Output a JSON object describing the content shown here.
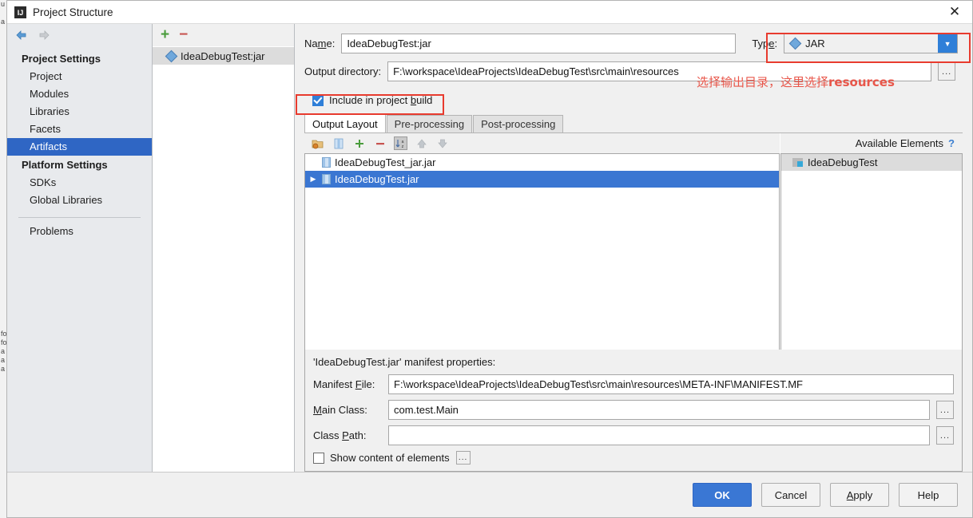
{
  "background_fragments": [
    "u",
    "a",
    "",
    "",
    "",
    "",
    "",
    "",
    "fo",
    "fo",
    "a",
    "a",
    "a"
  ],
  "window": {
    "icon": "intellij-idea-icon",
    "title": "Project Structure",
    "close_label": "✕"
  },
  "nav": {
    "back_icon": "arrow-left-icon",
    "forward_icon": "arrow-right-icon",
    "groups": [
      {
        "label": "Project Settings",
        "items": [
          {
            "label": "Project",
            "selected": false
          },
          {
            "label": "Modules",
            "selected": false
          },
          {
            "label": "Libraries",
            "selected": false
          },
          {
            "label": "Facets",
            "selected": false
          },
          {
            "label": "Artifacts",
            "selected": true
          }
        ]
      },
      {
        "label": "Platform Settings",
        "items": [
          {
            "label": "SDKs",
            "selected": false
          },
          {
            "label": "Global Libraries",
            "selected": false
          }
        ]
      }
    ],
    "problems": {
      "label": "Problems"
    }
  },
  "artifacts_panel": {
    "add_label": "+",
    "remove_label": "−",
    "items": [
      {
        "label": "IdeaDebugTest:jar",
        "selected": true
      }
    ]
  },
  "editor": {
    "name": {
      "label": "Name:",
      "value": "IdeaDebugTest:jar"
    },
    "type": {
      "label": "Type:",
      "value": "JAR",
      "arrow": "▼"
    },
    "output_directory": {
      "label": "Output directory:",
      "value": "F:\\workspace\\IdeaProjects\\IdeaDebugTest\\src\\main\\resources",
      "browse_label": "..."
    },
    "include_in_build": {
      "label_prefix": "Include in project ",
      "label_mnemonic": "b",
      "label_suffix": "uild",
      "checked": true
    },
    "tabs": [
      {
        "label": "Output Layout",
        "active": true
      },
      {
        "label": "Pre-processing",
        "active": false
      },
      {
        "label": "Post-processing",
        "active": false
      }
    ],
    "layout_toolbar": [
      {
        "name": "add-directory-icon",
        "glyph": "◪",
        "pressed": false
      },
      {
        "name": "add-archive-icon",
        "glyph": "▓",
        "pressed": false
      },
      {
        "name": "add-icon",
        "glyph": "+",
        "pressed": false
      },
      {
        "name": "remove-icon",
        "glyph": "−",
        "pressed": false
      },
      {
        "name": "sort-az-icon",
        "glyph": "↓",
        "pressed": true
      },
      {
        "name": "move-up-icon",
        "glyph": "↑",
        "pressed": false
      },
      {
        "name": "move-down-icon",
        "glyph": "↓",
        "pressed": false
      }
    ],
    "tree": [
      {
        "label": "IdeaDebugTest_jar.jar",
        "selected": false,
        "twisty": "",
        "indent": 0
      },
      {
        "label": "IdeaDebugTest.jar",
        "selected": true,
        "twisty": "▶",
        "indent": 0
      }
    ],
    "available_elements": {
      "title": "Available Elements",
      "help_label": "?",
      "items": [
        {
          "label": "IdeaDebugTest"
        }
      ]
    },
    "manifest": {
      "title": "'IdeaDebugTest.jar' manifest properties:",
      "manifest_file": {
        "label": "Manifest File:",
        "value": "F:\\workspace\\IdeaProjects\\IdeaDebugTest\\src\\main\\resources\\META-INF\\MANIFEST.MF"
      },
      "main_class": {
        "label": "Main Class:",
        "value": "com.test.Main",
        "browse_label": "..."
      },
      "class_path": {
        "label": "Class Path:",
        "value": "",
        "browse_label": "..."
      },
      "show_content": {
        "label": "Show content of elements",
        "checked": false,
        "browse_label": "..."
      }
    }
  },
  "annotations": {
    "output_dir_note_prefix": "选择输出目录，这里选择",
    "output_dir_note_emphasis": "resources"
  },
  "footer": {
    "ok": "OK",
    "cancel": "Cancel",
    "apply": "Apply",
    "help": "Help"
  },
  "colors": {
    "selection_blue": "#3a76d2",
    "nav_selection": "#2f66c4",
    "annotation_red": "#e83b2e",
    "primary_button": "#3a77d4",
    "add_green": "#4a9c3c",
    "remove_red": "#c75450"
  }
}
